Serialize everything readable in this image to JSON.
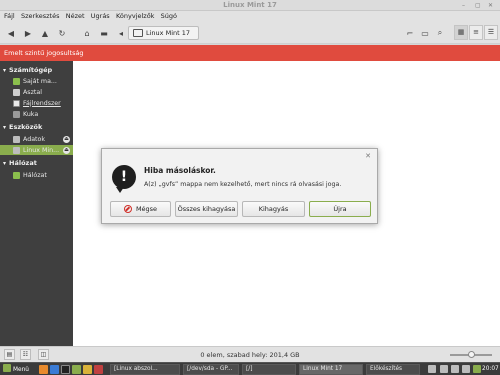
{
  "window": {
    "title": "Linux Mint 17",
    "controls": {
      "minimize": "–",
      "maximize": "▢",
      "close": "✕"
    }
  },
  "menu": [
    "Fájl",
    "Szerkesztés",
    "Nézet",
    "Ugrás",
    "Könyvjelzők",
    "Súgó"
  ],
  "toolbar": {
    "buttons": [
      "back-icon",
      "forward-icon",
      "up-icon",
      "reload-icon",
      "home-icon",
      "computer-icon",
      "toggle-location-icon"
    ],
    "breadcrumb": "Linux Mint 17",
    "right_buttons": [
      "terminal-icon",
      "new-folder-icon",
      "search-icon",
      "icon-view-icon",
      "list-view-icon",
      "compact-view-icon"
    ]
  },
  "warning": {
    "text": "Emelt szintű jogosultság",
    "color": "#e04b3e"
  },
  "sidebar": {
    "sections": [
      {
        "title": "Számítógép",
        "items": [
          "Saját ma...",
          "Asztal",
          "Fájlrendszer",
          "Kuka"
        ]
      },
      {
        "title": "Eszközök",
        "items": [
          "Adatok",
          "Linux Min..."
        ]
      },
      {
        "title": "Hálózat",
        "items": [
          "Hálózat"
        ]
      }
    ],
    "selected": "Linux Min...",
    "accent": "#8aad4d"
  },
  "dialog": {
    "title": "Hiba másoláskor.",
    "message": "A(z) „gvfs” mappa nem kezelhető, mert nincs rá olvasási joga.",
    "buttons": {
      "cancel": "Mégse",
      "skip_all": "Összes kihagyása",
      "skip": "Kihagyás",
      "retry": "Újra"
    }
  },
  "status": {
    "text": "0 elem, szabad hely: 201,4 GB",
    "zoom_level": 0.5
  },
  "taskbar": {
    "menu": "Menü",
    "windows": [
      "[Linux abszol...",
      "[/dev/sda - GP...",
      "[/]",
      "Linux Mint 17",
      "Előkészítés"
    ],
    "active_window": "Linux Mint 17",
    "clock": "20:07"
  }
}
